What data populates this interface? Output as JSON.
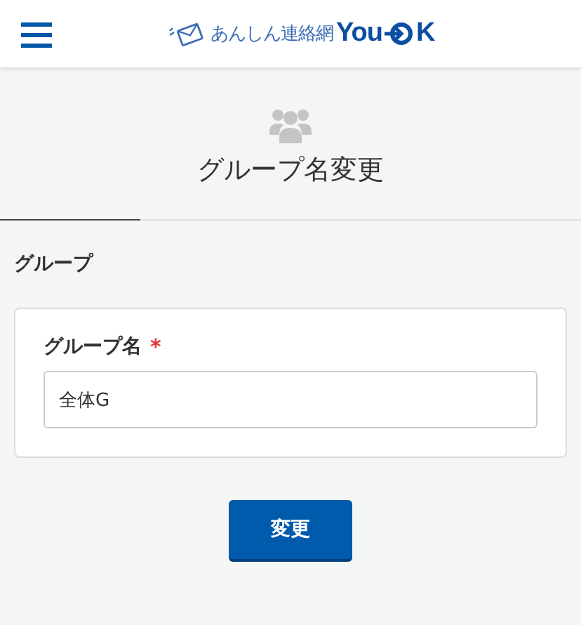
{
  "header": {
    "logo": {
      "tagline": "あんしん連絡網",
      "brand_start": "You",
      "brand_end": "K"
    }
  },
  "page": {
    "title": "グループ名変更"
  },
  "section": {
    "title": "グループ"
  },
  "form": {
    "fields": [
      {
        "label": "グループ名",
        "required": true,
        "required_mark": "*",
        "value": "全体G"
      }
    ]
  },
  "submit": {
    "label": "変更"
  }
}
